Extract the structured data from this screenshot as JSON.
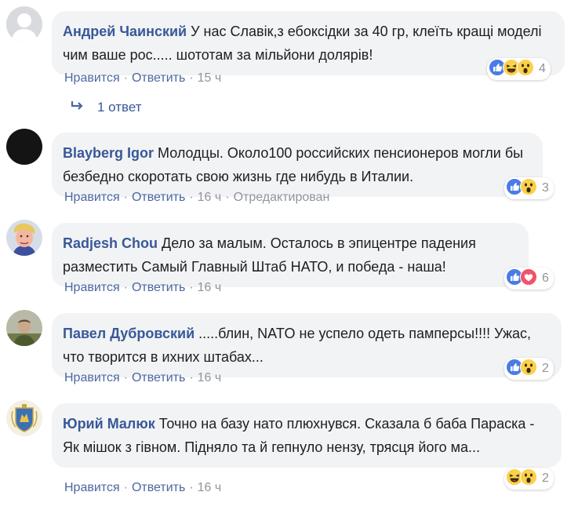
{
  "actions": {
    "like": "Нравится",
    "reply": "Ответить",
    "sep": "·"
  },
  "reply_link": "1 ответ",
  "comments": [
    {
      "author": "Андрей Чаинский",
      "text": "У нас Славік,з ебоксідки за 40 гр, клеїть кращі моделі чим ваше рос..... шототам за мільйони долярів!",
      "time": "15 ч",
      "edited": "",
      "reactions": [
        "like-icon",
        "haha-icon",
        "wow-icon"
      ],
      "count": "4"
    },
    {
      "author": "Blayberg Igor",
      "text": "Молодцы. Около100 российских пенсионеров могли бы безбедно скоротать свою жизнь где нибудь в Италии.",
      "time": "16 ч",
      "edited": "Отредактирован",
      "reactions": [
        "like-icon",
        "wow-icon"
      ],
      "count": "3"
    },
    {
      "author": "Radjesh Chou",
      "text": "Дело за малым. Осталось в эпицентре падения разместить Самый Главный Штаб НАТО, и победа - наша!",
      "time": "16 ч",
      "edited": "",
      "reactions": [
        "like-icon",
        "love-icon"
      ],
      "count": "6"
    },
    {
      "author": "Павел Дубровский",
      "text": ".....блин, NATO не успело одеть памперсы!!!! Ужас, что творится в ихних штабах...",
      "time": "16 ч",
      "edited": "",
      "reactions": [
        "like-icon",
        "wow-icon"
      ],
      "count": "2"
    },
    {
      "author": "Юрий Малюк",
      "text": "Точно на базу нато плюхнувся. Сказала б баба Параска - Як мішок з гівном. Підняло та й гепнуло нензу, трясця його ма...",
      "time": "16 ч",
      "edited": "",
      "reactions": [
        "haha-icon",
        "wow-icon"
      ],
      "count": "2"
    }
  ],
  "colors": {
    "author": "#385898",
    "link": "#4b67a1",
    "bubble": "#f2f3f5",
    "meta": "#90949c",
    "like": "#4a7ce6",
    "love": "#f25268",
    "emoji": "#fbd14b"
  }
}
